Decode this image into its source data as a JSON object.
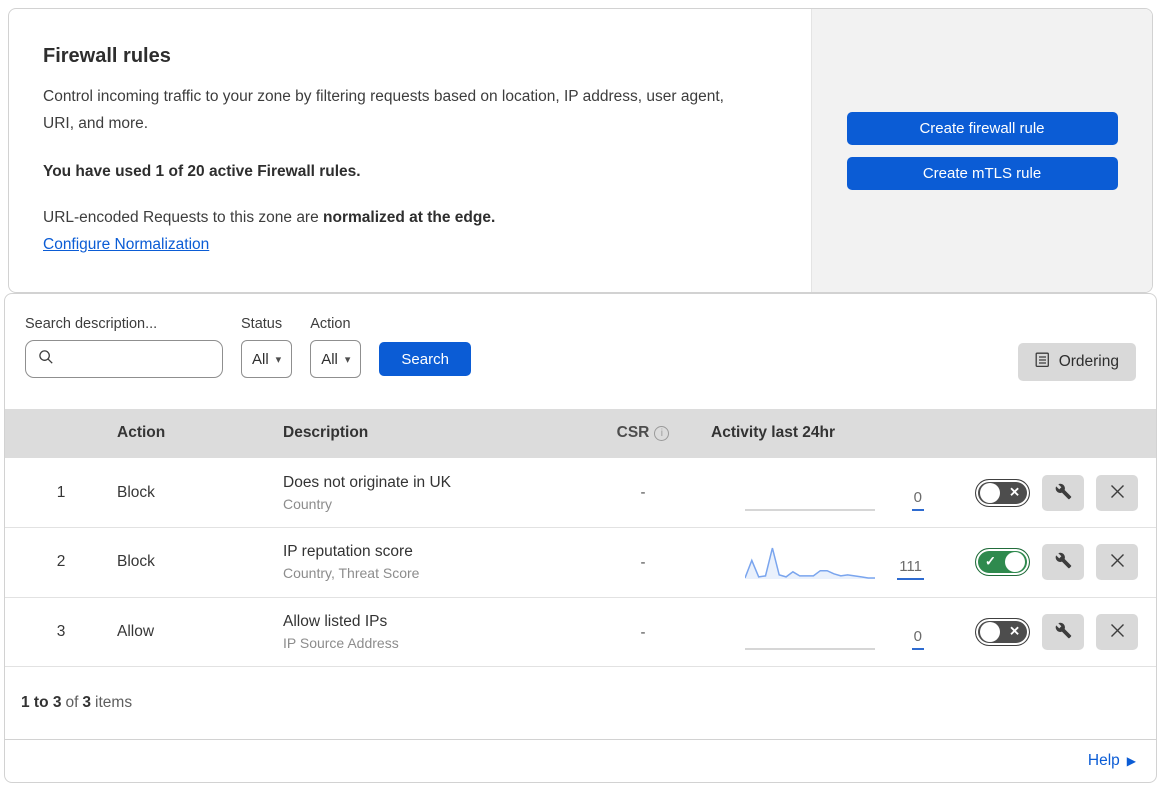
{
  "colors": {
    "accent_blue": "#0b5cd5",
    "link_blue": "#0b5cd5",
    "toggle_on_green": "#2f8a4e",
    "toggle_off_gray": "#4d4d4d",
    "sparkline_blue": "#7aa5ee",
    "side_panel_gray": "#f2f2f2",
    "table_header_gray": "#dcdcdc",
    "gray_button": "#d9d9d9"
  },
  "header": {
    "title": "Firewall rules",
    "description": "Control incoming traffic to your zone by filtering requests based on location, IP address, user agent, URI, and more.",
    "usage_note": "You have used 1 of 20 active Firewall rules.",
    "normalization_prefix": "URL-encoded Requests to this zone are",
    "normalization_bold": "normalized at the edge.",
    "normalization_link": "Configure Normalization",
    "create_firewall_rule_label": "Create firewall rule",
    "create_mtls_rule_label": "Create mTLS rule"
  },
  "filters": {
    "search_label": "Search description...",
    "status_label": "Status",
    "status_value": "All",
    "action_label": "Action",
    "action_value": "All",
    "search_button_label": "Search",
    "ordering_button_label": "Ordering"
  },
  "table": {
    "columns": {
      "action": "Action",
      "description": "Description",
      "csr": "CSR",
      "activity": "Activity last 24hr"
    },
    "rows": [
      {
        "priority": "1",
        "action": "Block",
        "description": "Does not originate in UK",
        "fields": "Country",
        "csr": "-",
        "activity": "0",
        "enabled": false
      },
      {
        "priority": "2",
        "action": "Block",
        "description": "IP reputation score",
        "fields": "Country, Threat Score",
        "csr": "-",
        "activity": "111",
        "enabled": true
      },
      {
        "priority": "3",
        "action": "Allow",
        "description": "Allow listed IPs",
        "fields": "IP Source Address",
        "csr": "-",
        "activity": "0",
        "enabled": false
      }
    ]
  },
  "footer": {
    "range": "1 to 3",
    "of_label": "of",
    "total": "3",
    "items_label": "items"
  },
  "help_link": {
    "label": "Help"
  },
  "chart_data": [
    {
      "type": "area",
      "title": "Activity last 24hr - rule 1",
      "values": [
        0,
        0,
        0,
        0,
        0,
        0,
        0,
        0,
        0,
        0,
        0,
        0,
        0,
        0,
        0,
        0,
        0,
        0,
        0,
        0
      ],
      "total": 0,
      "xlabel": "",
      "ylabel": "",
      "grid": false,
      "legend": false
    },
    {
      "type": "area",
      "title": "Activity last 24hr - rule 2",
      "values": [
        1,
        18,
        2,
        3,
        30,
        4,
        2,
        7,
        3,
        3,
        3,
        8,
        8,
        5,
        3,
        4,
        3,
        2,
        1,
        1
      ],
      "total": 111,
      "xlabel": "",
      "ylabel": "",
      "grid": false,
      "legend": false
    },
    {
      "type": "area",
      "title": "Activity last 24hr - rule 3",
      "values": [
        0,
        0,
        0,
        0,
        0,
        0,
        0,
        0,
        0,
        0,
        0,
        0,
        0,
        0,
        0,
        0,
        0,
        0,
        0,
        0
      ],
      "total": 0,
      "xlabel": "",
      "ylabel": "",
      "grid": false,
      "legend": false
    }
  ]
}
